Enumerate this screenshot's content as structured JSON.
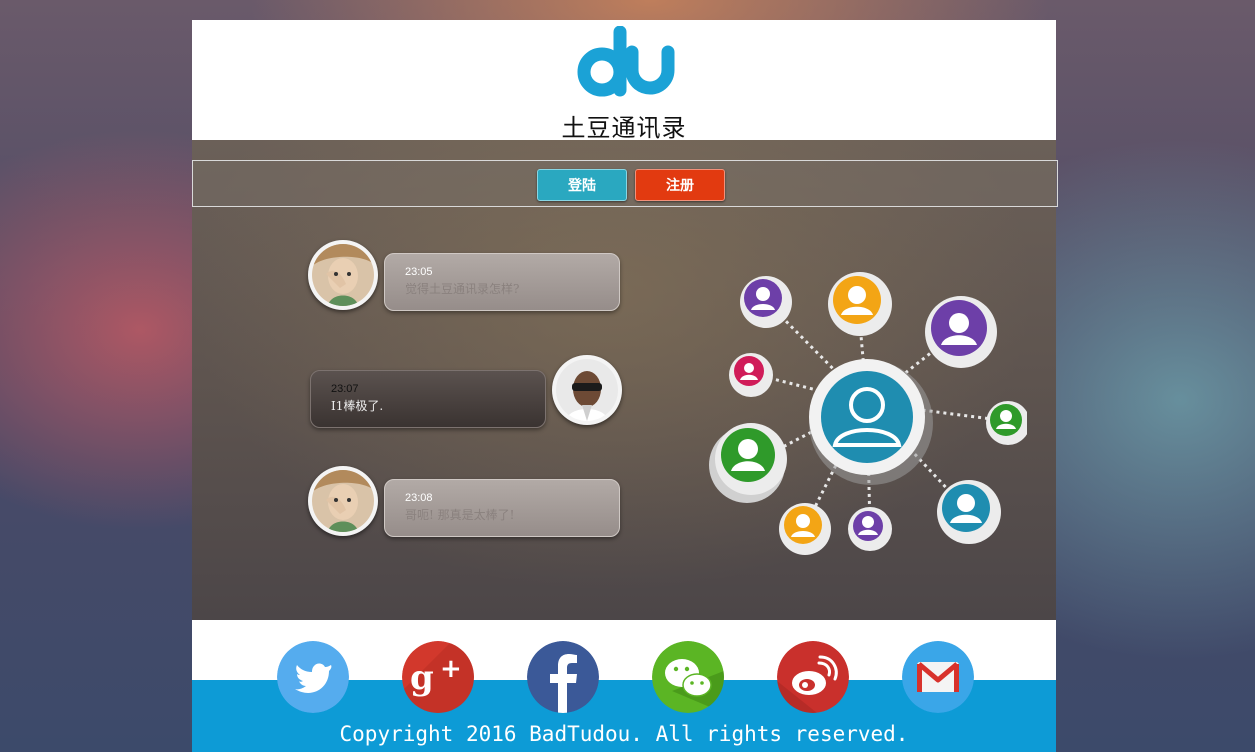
{
  "header": {
    "logo_mark": "du",
    "title": "土豆通讯录"
  },
  "nav": {
    "login_label": "登陆",
    "register_label": "注册"
  },
  "chats": [
    {
      "time": "23:05",
      "text": "觉得土豆通讯录怎样?"
    },
    {
      "time": "23:07",
      "text": "I1棒极了."
    },
    {
      "time": "23:08",
      "text": "哥呃! 那真是太棒了!"
    }
  ],
  "social_icons": [
    "twitter-icon",
    "google-plus-icon",
    "facebook-icon",
    "wechat-icon",
    "weibo-icon",
    "mail-icon"
  ],
  "footer": {
    "copyright": "Copyright 2016 BadTudou. All rights reserved."
  },
  "colors": {
    "brand_blue": "#1ba2d6",
    "login_btn": "#2aa8c0",
    "register_btn": "#e23a10",
    "footer_blue": "#0d9bd6"
  }
}
